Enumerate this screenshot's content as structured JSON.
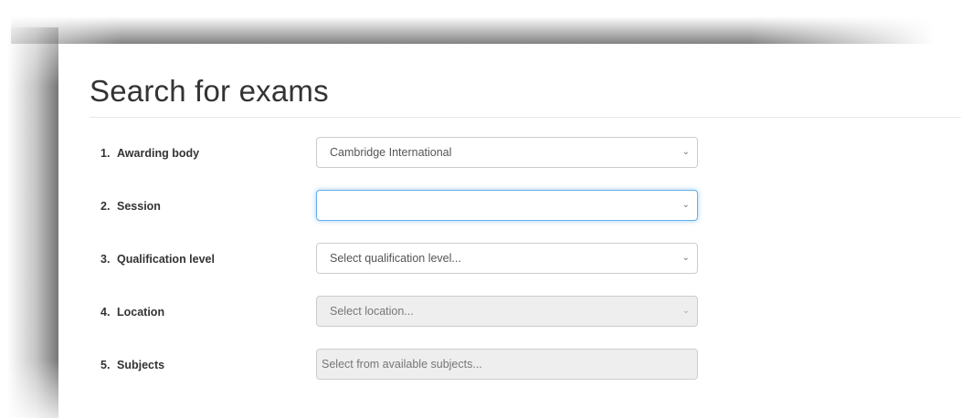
{
  "page": {
    "title": "Search for exams"
  },
  "form": {
    "fields": [
      {
        "number": "1.",
        "label": "Awarding body",
        "value": "Cambridge International"
      },
      {
        "number": "2.",
        "label": "Session",
        "value": ""
      },
      {
        "number": "3.",
        "label": "Qualification level",
        "placeholder": "Select qualification level..."
      },
      {
        "number": "4.",
        "label": "Location",
        "placeholder": "Select location..."
      },
      {
        "number": "5.",
        "label": "Subjects",
        "placeholder": "Select from available subjects..."
      }
    ]
  },
  "icons": {
    "dropdown": "chevron-down-icon"
  },
  "colors": {
    "focus_border": "#66afe9",
    "disabled_bg": "#eeeeee"
  }
}
